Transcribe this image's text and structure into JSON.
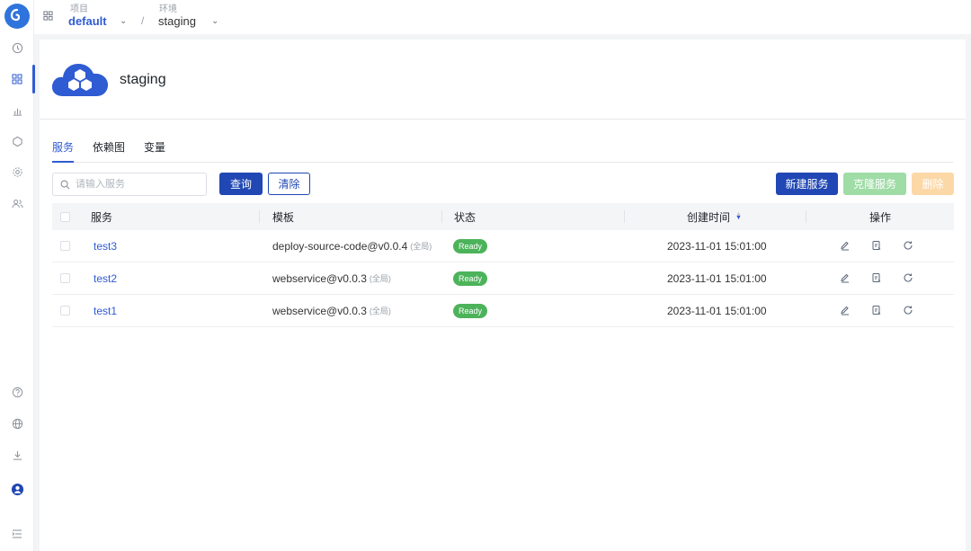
{
  "breadcrumb": {
    "project_caption": "项目",
    "project_value": "default",
    "separator": "/",
    "env_caption": "环境",
    "env_value": "staging"
  },
  "header": {
    "title": "staging"
  },
  "tabs": [
    {
      "label": "服务",
      "active": true
    },
    {
      "label": "依赖图",
      "active": false
    },
    {
      "label": "变量",
      "active": false
    }
  ],
  "toolbar": {
    "search_placeholder": "请输入服务",
    "query_label": "查询",
    "clear_label": "清除",
    "new_label": "新建服务",
    "clone_label": "克隆服务",
    "delete_label": "删除"
  },
  "table": {
    "columns": {
      "service": "服务",
      "template": "模板",
      "status": "状态",
      "created": "创建时间",
      "actions": "操作"
    },
    "rows": [
      {
        "service": "test3",
        "template": "deploy-source-code@v0.0.4",
        "scope": "(全局)",
        "status": "Ready",
        "created": "2023-11-01 15:01:00"
      },
      {
        "service": "test2",
        "template": "webservice@v0.0.3",
        "scope": "(全局)",
        "status": "Ready",
        "created": "2023-11-01 15:01:00"
      },
      {
        "service": "test1",
        "template": "webservice@v0.0.3",
        "scope": "(全局)",
        "status": "Ready",
        "created": "2023-11-01 15:01:00"
      }
    ]
  },
  "colors": {
    "primary": "#2047b3",
    "link": "#2f5bd3",
    "status_ready": "#4cb35a"
  }
}
